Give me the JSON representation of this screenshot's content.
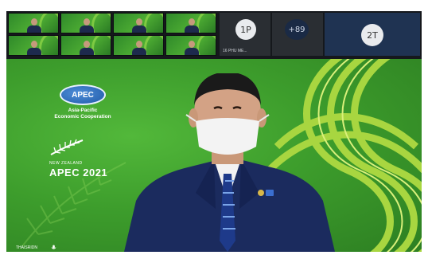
{
  "strip": {
    "tiles": [
      {
        "label": ""
      },
      {
        "label": ""
      },
      {
        "label": ""
      },
      {
        "label": ""
      },
      {
        "label": ""
      },
      {
        "label": ""
      },
      {
        "label": ""
      },
      {
        "label": ""
      }
    ],
    "participant_a": {
      "initials": "1P",
      "name": "16 PHU ME..."
    },
    "participant_b": {
      "initials": "+89"
    },
    "participant_c": {
      "initials": "2T"
    }
  },
  "stage": {
    "logo_text": "APEC",
    "org_line1": "Asia-Pacific",
    "org_line2": "Economic Cooperation",
    "country": "NEW ZEALAND",
    "event": "APEC 2021",
    "speaker_caption": "THAISRIDN"
  },
  "colors": {
    "background_green": "#3d9d2c",
    "pattern_lime": "#a8d640",
    "suit_navy": "#1b2b5e",
    "apec_blue": "#1f5aa8"
  }
}
